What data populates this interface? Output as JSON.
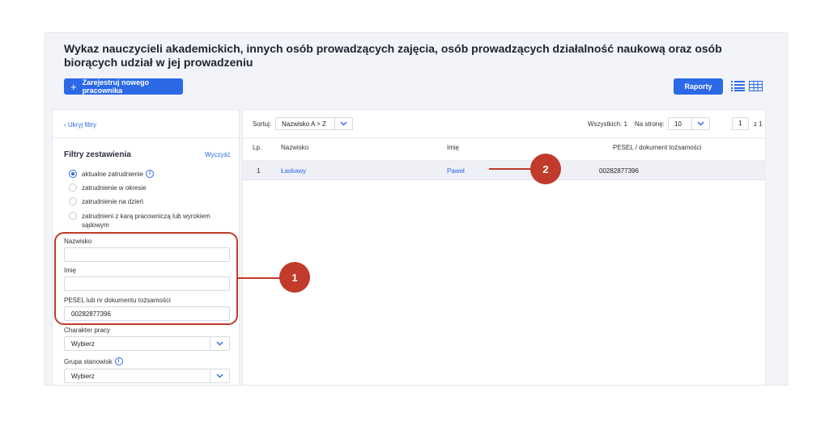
{
  "page": {
    "title": "Wykaz nauczycieli akademickich, innych osób prowadzących zajęcia, osób prowadzących działalność naukową oraz osób biorących udział w jej prowadzeniu",
    "register_button": "Zarejestruj nowego pracownika",
    "reports_button": "Raporty"
  },
  "filters": {
    "hide_link": "‹ Ukryj filtry",
    "title": "Filtry zestawienia",
    "clear_link": "Wyczyść",
    "radio_options": [
      "aktualne zatrudnienie",
      "zatrudnienie w okresie",
      "zatrudnienie na dzień",
      "zatrudnieni z karą pracowniczą lub wyrokiem sądowym"
    ],
    "selected_radio": 0,
    "surname_label": "Nazwisko",
    "surname_value": "",
    "name_label": "Imię",
    "name_value": "",
    "pesel_label": "PESEL lub nr dokumentu tożsamości",
    "pesel_value": "00282877396",
    "work_type_label": "Charakter pracy",
    "work_type_value": "Wybierz",
    "position_group_label": "Grupa stanowisk",
    "position_group_value": "Wybierz"
  },
  "toolbar": {
    "sort_label": "Sortuj:",
    "sort_value": "Nazwisko A > Z",
    "total_text": "Wszystkich: 1",
    "per_page_label": "Na stronę:",
    "per_page_value": "10",
    "page_value": "1",
    "page_of": "z 1"
  },
  "table": {
    "headers": [
      "Lp.",
      "Nazwisko",
      "Imię",
      "PESEL / dokument tożsamości"
    ],
    "rows": [
      [
        "1",
        "Łaskawy",
        "Paweł",
        "00282877396"
      ]
    ]
  },
  "annotations": {
    "badge_1": "1",
    "badge_2": "2",
    "accent_color": "#c13a2b"
  },
  "colors": {
    "primary": "#2b69e6"
  }
}
